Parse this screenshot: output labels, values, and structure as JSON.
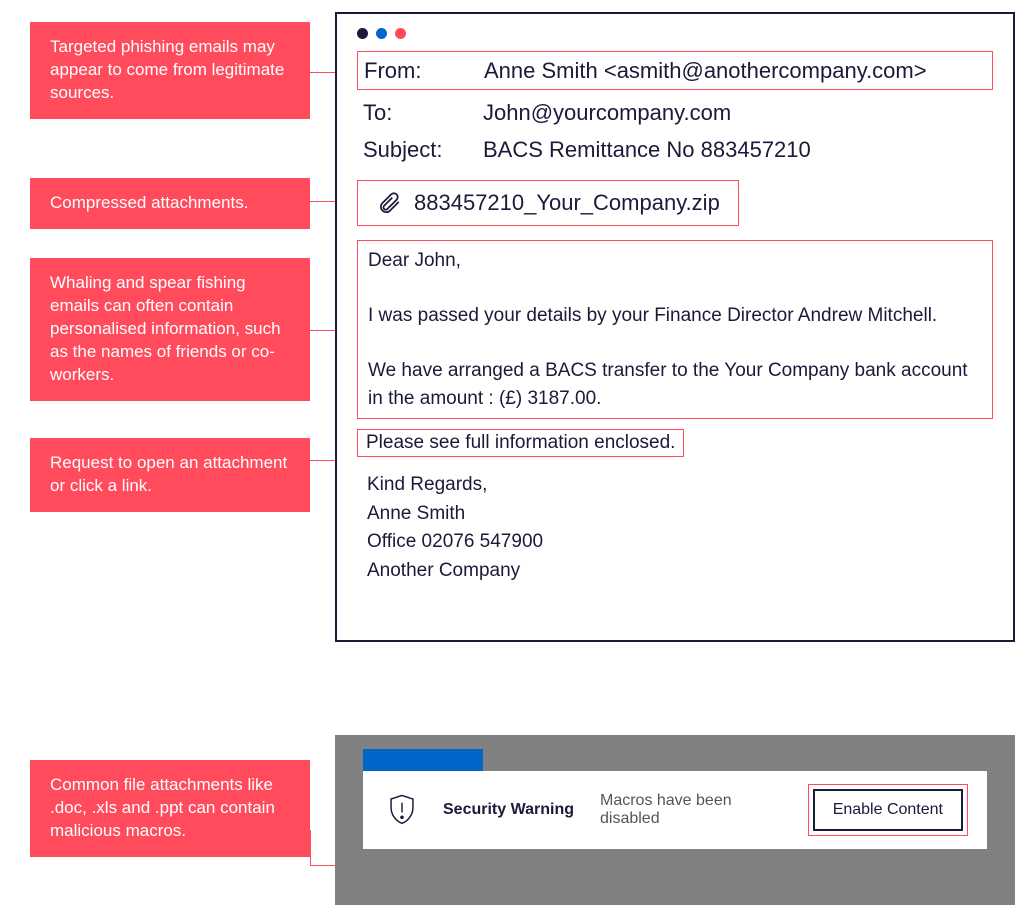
{
  "callouts": {
    "c1": "Targeted phishing emails may appear to come from legitimate sources.",
    "c2": "Compressed attachments.",
    "c3": "Whaling and spear fishing emails can often contain personalised information, such as the names of friends or co-workers.",
    "c4": "Request to open an attachment or click a link.",
    "c5": "Common file attachments like .doc, .xls and .ppt can contain malicious macros."
  },
  "email": {
    "from_label": "From:",
    "from_value": "Anne Smith <asmith@anothercompany.com>",
    "to_label": "To:",
    "to_value": "John@yourcompany.com",
    "subject_label": "Subject:",
    "subject_value": "BACS Remittance No 883457210",
    "attachment": "883457210_Your_Company.zip",
    "body_greeting": "Dear John,",
    "body_p1": "I was passed your details by your Finance Director Andrew Mitchell.",
    "body_p2": "We have arranged a BACS transfer to the Your Company bank account in the amount : (£) 3187.00.",
    "body_request": "Please see full information enclosed.",
    "signature_regards": "Kind Regards,",
    "signature_name": "Anne Smith",
    "signature_phone": "Office 02076 547900",
    "signature_company": "Another Company"
  },
  "macro": {
    "title": "Security Warning",
    "message": "Macros have been disabled",
    "button": "Enable Content"
  }
}
